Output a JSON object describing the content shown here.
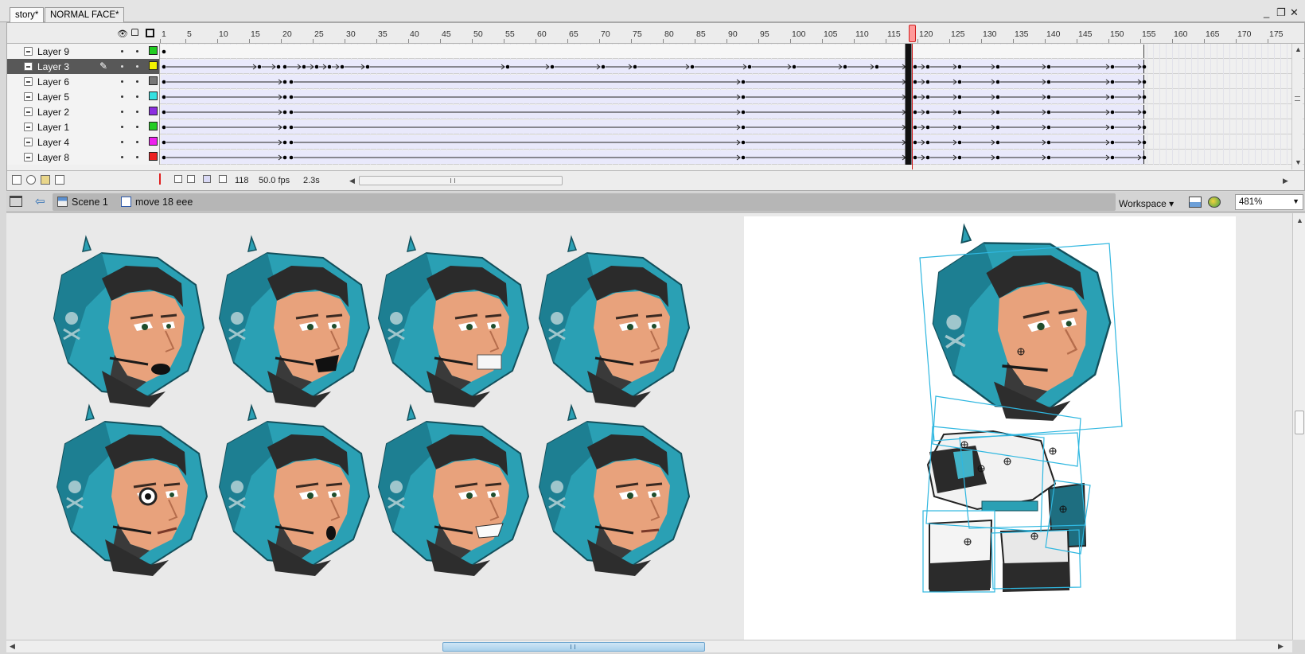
{
  "tabs": [
    {
      "label": "story*",
      "active": true
    },
    {
      "label": "NORMAL FACE*",
      "active": false
    }
  ],
  "window_controls": {
    "minimize": "_",
    "restore": "❐",
    "close": "✕"
  },
  "timeline": {
    "ruler_labels": [
      "1",
      "5",
      "10",
      "15",
      "20",
      "25",
      "30",
      "35",
      "40",
      "45",
      "50",
      "55",
      "60",
      "65",
      "70",
      "75",
      "80",
      "85",
      "90",
      "95",
      "100",
      "105",
      "110",
      "115",
      "120",
      "125",
      "130",
      "135",
      "140",
      "145",
      "150",
      "155",
      "160",
      "165",
      "170",
      "175"
    ],
    "current_frame": 118,
    "layers": [
      {
        "name": "Layer 9",
        "color": "#22cc22",
        "selected": false,
        "keyframes": [
          1
        ],
        "span_end": 155,
        "span": false
      },
      {
        "name": "Layer 3",
        "color": "#f2f200",
        "selected": true,
        "keyframes": [
          1,
          16,
          19,
          20,
          23,
          25,
          27,
          29,
          33,
          55,
          62,
          70,
          75,
          84,
          93,
          100,
          108,
          113,
          118,
          119,
          121,
          126,
          132,
          140,
          150,
          155
        ],
        "span_end": 155,
        "span": true
      },
      {
        "name": "Layer 6",
        "color": "#777777",
        "selected": false,
        "keyframes": [
          1,
          20,
          21,
          92,
          118,
          119,
          121,
          126,
          132,
          140,
          150,
          155
        ],
        "span_end": 155,
        "span": true
      },
      {
        "name": "Layer 5",
        "color": "#33e0e0",
        "selected": false,
        "keyframes": [
          1,
          20,
          21,
          92,
          118,
          119,
          121,
          126,
          132,
          140,
          150,
          155
        ],
        "span_end": 155,
        "span": true
      },
      {
        "name": "Layer 2",
        "color": "#8c2ee0",
        "selected": false,
        "keyframes": [
          1,
          20,
          21,
          92,
          118,
          119,
          121,
          126,
          132,
          140,
          150,
          155
        ],
        "span_end": 155,
        "span": true
      },
      {
        "name": "Layer 1",
        "color": "#22cc22",
        "selected": false,
        "keyframes": [
          1,
          20,
          21,
          92,
          118,
          119,
          121,
          126,
          132,
          140,
          150,
          155
        ],
        "span_end": 155,
        "span": true
      },
      {
        "name": "Layer 4",
        "color": "#ee22ee",
        "selected": false,
        "keyframes": [
          1,
          20,
          21,
          92,
          118,
          119,
          121,
          126,
          132,
          140,
          150,
          155
        ],
        "span_end": 155,
        "span": true
      },
      {
        "name": "Layer 8",
        "color": "#ee2222",
        "selected": false,
        "keyframes": [
          1,
          20,
          21,
          92,
          118,
          119,
          121,
          126,
          132,
          140,
          150,
          155
        ],
        "span_end": 155,
        "span": true
      }
    ],
    "footer": {
      "frame": "118",
      "fps": "50.0 fps",
      "time": "2.3s"
    }
  },
  "edit_bar": {
    "scene": "Scene 1",
    "symbol": "move 18 eee",
    "workspace": "Workspace",
    "zoom": "481%"
  },
  "stage": {
    "face_grid": [
      {
        "expression": "talking-open"
      },
      {
        "expression": "shouting"
      },
      {
        "expression": "grimace"
      },
      {
        "expression": "smirk"
      },
      {
        "expression": "surprised-eye"
      },
      {
        "expression": "speaking-o"
      },
      {
        "expression": "grin-teeth"
      },
      {
        "expression": "neutral"
      }
    ],
    "character": "space-helmet-character-selected"
  },
  "colors": {
    "helmet": "#2aa0b4",
    "helmet_dark": "#15606e",
    "skin": "#e8a27c",
    "selection": "#2fb7e0",
    "timeline_fill": "#e9e9fb",
    "playhead": "#d01818"
  }
}
